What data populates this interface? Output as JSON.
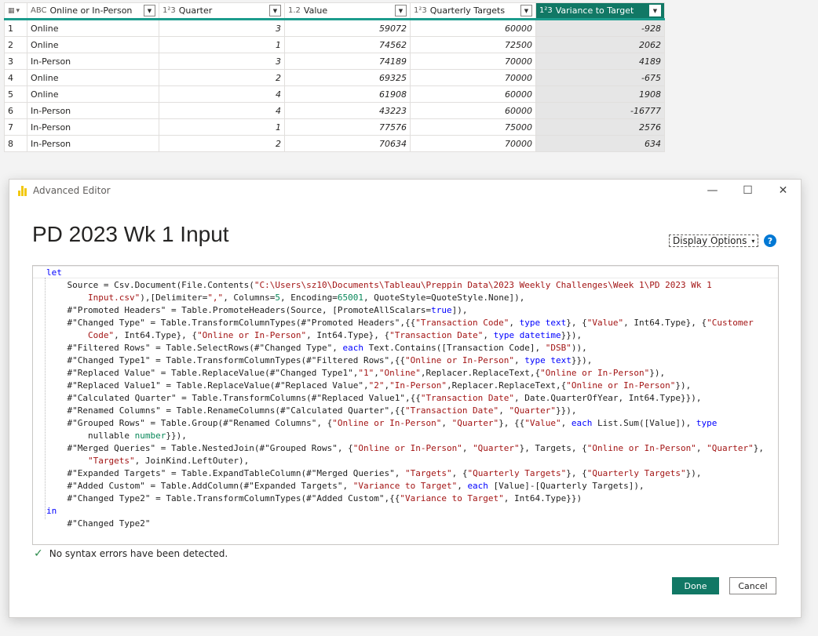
{
  "grid": {
    "columns": [
      {
        "type_glyph": "A<sup>B</sup><sub>C</sub>",
        "type_label": "ABC",
        "name": "Online or In-Person"
      },
      {
        "type_label": "1²3",
        "name": "Quarter"
      },
      {
        "type_label": "1.2",
        "name": "Value"
      },
      {
        "type_label": "1²3",
        "name": "Quarterly Targets"
      },
      {
        "type_label": "1²3",
        "name": "Variance to Target"
      }
    ],
    "rows": [
      {
        "idx": "1",
        "mode": "Online",
        "quarter": "3",
        "value": "59072",
        "target": "60000",
        "variance": "-928"
      },
      {
        "idx": "2",
        "mode": "Online",
        "quarter": "1",
        "value": "74562",
        "target": "72500",
        "variance": "2062"
      },
      {
        "idx": "3",
        "mode": "In-Person",
        "quarter": "3",
        "value": "74189",
        "target": "70000",
        "variance": "4189"
      },
      {
        "idx": "4",
        "mode": "Online",
        "quarter": "2",
        "value": "69325",
        "target": "70000",
        "variance": "-675"
      },
      {
        "idx": "5",
        "mode": "Online",
        "quarter": "4",
        "value": "61908",
        "target": "60000",
        "variance": "1908"
      },
      {
        "idx": "6",
        "mode": "In-Person",
        "quarter": "4",
        "value": "43223",
        "target": "60000",
        "variance": "-16777"
      },
      {
        "idx": "7",
        "mode": "In-Person",
        "quarter": "1",
        "value": "77576",
        "target": "75000",
        "variance": "2576"
      },
      {
        "idx": "8",
        "mode": "In-Person",
        "quarter": "2",
        "value": "70634",
        "target": "70000",
        "variance": "634"
      }
    ]
  },
  "dialog": {
    "window_title": "Advanced Editor",
    "query_name": "PD 2023 Wk 1 Input",
    "display_options": "Display Options",
    "help": "?",
    "status": "No syntax errors have been detected.",
    "done": "Done",
    "cancel": "Cancel"
  },
  "code_lines": [
    [
      {
        "t": "let",
        "c": "kw"
      }
    ],
    [
      {
        "t": "    Source = Csv.Document(File.Contents("
      },
      {
        "t": "\"C:\\Users\\sz10\\Documents\\Tableau\\Preppin Data\\2023 Weekly Challenges\\Week 1\\PD 2023 Wk 1",
        "c": "str"
      }
    ],
    [
      {
        "t": "        Input.csv\"",
        "c": "str"
      },
      {
        "t": "),[Delimiter="
      },
      {
        "t": "\",\"",
        "c": "str"
      },
      {
        "t": ", Columns="
      },
      {
        "t": "5",
        "c": "num-c"
      },
      {
        "t": ", Encoding="
      },
      {
        "t": "65001",
        "c": "num-c"
      },
      {
        "t": ", QuoteStyle=QuoteStyle.None]),"
      }
    ],
    [
      {
        "t": "    #\"Promoted Headers\" = Table.PromoteHeaders(Source, [PromoteAllScalars="
      },
      {
        "t": "true",
        "c": "kw"
      },
      {
        "t": "]),"
      }
    ],
    [
      {
        "t": "    #\"Changed Type\" = Table.TransformColumnTypes(#\"Promoted Headers\",{{"
      },
      {
        "t": "\"Transaction Code\"",
        "c": "str"
      },
      {
        "t": ", "
      },
      {
        "t": "type text",
        "c": "kw"
      },
      {
        "t": "}, {"
      },
      {
        "t": "\"Value\"",
        "c": "str"
      },
      {
        "t": ", Int64.Type}, {"
      },
      {
        "t": "\"Customer",
        "c": "str"
      }
    ],
    [
      {
        "t": "        Code\"",
        "c": "str"
      },
      {
        "t": ", Int64.Type}, {"
      },
      {
        "t": "\"Online or In-Person\"",
        "c": "str"
      },
      {
        "t": ", Int64.Type}, {"
      },
      {
        "t": "\"Transaction Date\"",
        "c": "str"
      },
      {
        "t": ", "
      },
      {
        "t": "type datetime",
        "c": "kw"
      },
      {
        "t": "}}),"
      }
    ],
    [
      {
        "t": "    #\"Filtered Rows\" = Table.SelectRows(#\"Changed Type\", "
      },
      {
        "t": "each",
        "c": "kw"
      },
      {
        "t": " Text.Contains([Transaction Code], "
      },
      {
        "t": "\"DSB\"",
        "c": "str"
      },
      {
        "t": ")),"
      }
    ],
    [
      {
        "t": "    #\"Changed Type1\" = Table.TransformColumnTypes(#\"Filtered Rows\",{{"
      },
      {
        "t": "\"Online or In-Person\"",
        "c": "str"
      },
      {
        "t": ", "
      },
      {
        "t": "type text",
        "c": "kw"
      },
      {
        "t": "}}),"
      }
    ],
    [
      {
        "t": "    #\"Replaced Value\" = Table.ReplaceValue(#\"Changed Type1\","
      },
      {
        "t": "\"1\"",
        "c": "str"
      },
      {
        "t": ","
      },
      {
        "t": "\"Online\"",
        "c": "str"
      },
      {
        "t": ",Replacer.ReplaceText,{"
      },
      {
        "t": "\"Online or In-Person\"",
        "c": "str"
      },
      {
        "t": "}),"
      }
    ],
    [
      {
        "t": "    #\"Replaced Value1\" = Table.ReplaceValue(#\"Replaced Value\","
      },
      {
        "t": "\"2\"",
        "c": "str"
      },
      {
        "t": ","
      },
      {
        "t": "\"In-Person\"",
        "c": "str"
      },
      {
        "t": ",Replacer.ReplaceText,{"
      },
      {
        "t": "\"Online or In-Person\"",
        "c": "str"
      },
      {
        "t": "}),"
      }
    ],
    [
      {
        "t": "    #\"Calculated Quarter\" = Table.TransformColumns(#\"Replaced Value1\",{{"
      },
      {
        "t": "\"Transaction Date\"",
        "c": "str"
      },
      {
        "t": ", Date.QuarterOfYear, Int64.Type}}),"
      }
    ],
    [
      {
        "t": "    #\"Renamed Columns\" = Table.RenameColumns(#\"Calculated Quarter\",{{"
      },
      {
        "t": "\"Transaction Date\"",
        "c": "str"
      },
      {
        "t": ", "
      },
      {
        "t": "\"Quarter\"",
        "c": "str"
      },
      {
        "t": "}}),"
      }
    ],
    [
      {
        "t": "    #\"Grouped Rows\" = Table.Group(#\"Renamed Columns\", {"
      },
      {
        "t": "\"Online or In-Person\"",
        "c": "str"
      },
      {
        "t": ", "
      },
      {
        "t": "\"Quarter\"",
        "c": "str"
      },
      {
        "t": "}, {{"
      },
      {
        "t": "\"Value\"",
        "c": "str"
      },
      {
        "t": ", "
      },
      {
        "t": "each",
        "c": "kw"
      },
      {
        "t": " List.Sum([Value]), "
      },
      {
        "t": "type",
        "c": "kw"
      }
    ],
    [
      {
        "t": "        nullable "
      },
      {
        "t": "number",
        "c": "num-c"
      },
      {
        "t": "}}),"
      }
    ],
    [
      {
        "t": "    #\"Merged Queries\" = Table.NestedJoin(#\"Grouped Rows\", {"
      },
      {
        "t": "\"Online or In-Person\"",
        "c": "str"
      },
      {
        "t": ", "
      },
      {
        "t": "\"Quarter\"",
        "c": "str"
      },
      {
        "t": "}, Targets, {"
      },
      {
        "t": "\"Online or In-Person\"",
        "c": "str"
      },
      {
        "t": ", "
      },
      {
        "t": "\"Quarter\"",
        "c": "str"
      },
      {
        "t": "},"
      }
    ],
    [
      {
        "t": "        "
      },
      {
        "t": "\"Targets\"",
        "c": "str"
      },
      {
        "t": ", JoinKind.LeftOuter),"
      }
    ],
    [
      {
        "t": "    #\"Expanded Targets\" = Table.ExpandTableColumn(#\"Merged Queries\", "
      },
      {
        "t": "\"Targets\"",
        "c": "str"
      },
      {
        "t": ", {"
      },
      {
        "t": "\"Quarterly Targets\"",
        "c": "str"
      },
      {
        "t": "}, {"
      },
      {
        "t": "\"Quarterly Targets\"",
        "c": "str"
      },
      {
        "t": "}),"
      }
    ],
    [
      {
        "t": "    #\"Added Custom\" = Table.AddColumn(#\"Expanded Targets\", "
      },
      {
        "t": "\"Variance to Target\"",
        "c": "str"
      },
      {
        "t": ", "
      },
      {
        "t": "each",
        "c": "kw"
      },
      {
        "t": " [Value]-[Quarterly Targets]),"
      }
    ],
    [
      {
        "t": "    #\"Changed Type2\" = Table.TransformColumnTypes(#\"Added Custom\",{{"
      },
      {
        "t": "\"Variance to Target\"",
        "c": "str"
      },
      {
        "t": ", Int64.Type}})"
      }
    ],
    [
      {
        "t": "in",
        "c": "kw"
      }
    ],
    [
      {
        "t": "    #\"Changed Type2\""
      }
    ]
  ]
}
